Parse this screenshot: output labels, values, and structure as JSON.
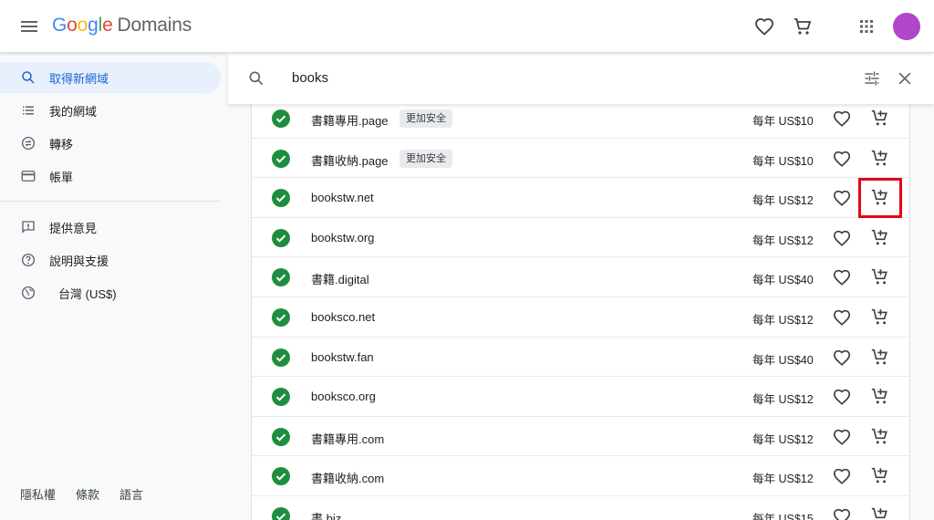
{
  "header": {
    "logo_letters": [
      "G",
      "o",
      "o",
      "g",
      "l",
      "e"
    ],
    "product": "Domains",
    "icons": [
      "menu-icon",
      "heart-icon",
      "cart-icon",
      "apps-grid-icon",
      "avatar"
    ],
    "avatar_color": "#b046c8"
  },
  "sidebar": {
    "items": [
      {
        "label": "取得新網域",
        "icon": "search-icon"
      },
      {
        "label": "我的網域",
        "icon": "list-icon"
      },
      {
        "label": "轉移",
        "icon": "transfer-icon"
      },
      {
        "label": "帳單",
        "icon": "credit-card-icon"
      },
      {
        "label": "提供意見",
        "icon": "feedback-icon"
      },
      {
        "label": "說明與支援",
        "icon": "help-icon"
      },
      {
        "label": "台灣 (US$)",
        "icon": "globe-icon"
      }
    ],
    "footer": [
      "隱私權",
      "條款",
      "語言"
    ]
  },
  "search": {
    "query": "books",
    "icons": [
      "search-icon",
      "tune-icon",
      "close-icon"
    ]
  },
  "results": [
    {
      "domain": "書籍專用.page",
      "badge": "更加安全",
      "price": "每年 US$10"
    },
    {
      "domain": "書籍收納.page",
      "badge": "更加安全",
      "price": "每年 US$10"
    },
    {
      "domain": "bookstw.net",
      "badge": "",
      "price": "每年 US$12"
    },
    {
      "domain": "bookstw.org",
      "badge": "",
      "price": "每年 US$12"
    },
    {
      "domain": "書籍.digital",
      "badge": "",
      "price": "每年 US$40"
    },
    {
      "domain": "booksco.net",
      "badge": "",
      "price": "每年 US$12"
    },
    {
      "domain": "bookstw.fan",
      "badge": "",
      "price": "每年 US$40"
    },
    {
      "domain": "booksco.org",
      "badge": "",
      "price": "每年 US$12"
    },
    {
      "domain": "書籍專用.com",
      "badge": "",
      "price": "每年 US$12"
    },
    {
      "domain": "書籍收納.com",
      "badge": "",
      "price": "每年 US$12"
    },
    {
      "domain": "書.biz",
      "badge": "",
      "price": "每年 US$15"
    }
  ],
  "colors": {
    "active_nav": "#1967d2",
    "active_nav_bg": "#e8f0fe",
    "available_check": "#1e8e3e",
    "highlight_box": "#e30613"
  }
}
